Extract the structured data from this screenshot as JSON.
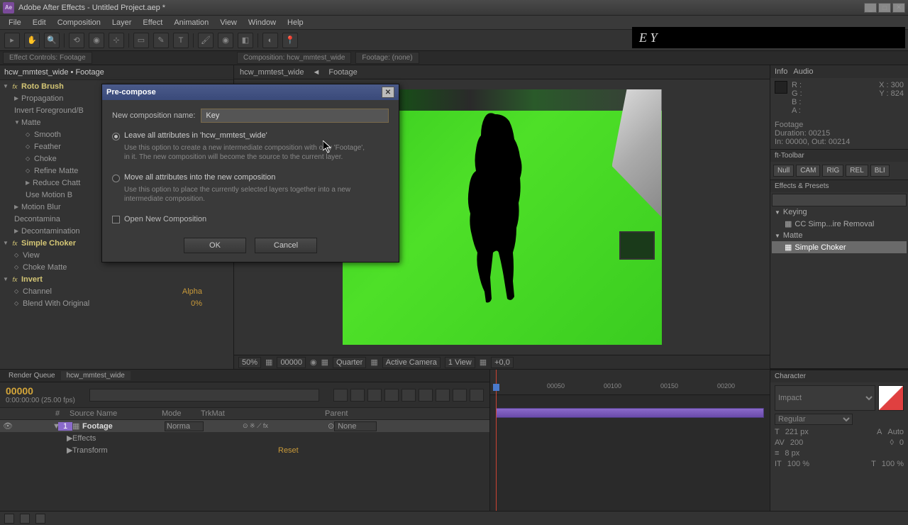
{
  "titlebar": {
    "app": "Ae",
    "title": "Adobe After Effects - Untitled Project.aep *"
  },
  "menu": [
    "File",
    "Edit",
    "Composition",
    "Layer",
    "Effect",
    "Animation",
    "View",
    "Window",
    "Help"
  ],
  "key_overlay": "E Y",
  "panel_tabs": {
    "left": "Effect Controls: Footage",
    "center": "Composition: hcw_mmtest_wide",
    "center2": "Footage: (none)"
  },
  "effect_controls": {
    "header": "hcw_mmtest_wide • Footage",
    "fx1": "Roto Brush",
    "fx1_items": [
      "Propagation",
      "Invert Foreground/B",
      "Matte",
      "Smooth",
      "Feather",
      "Choke",
      "Refine Matte",
      "Reduce Chatt",
      "Use Motion B",
      "Motion Blur",
      "Decontamina",
      "Decontamination"
    ],
    "fx2": "Simple Choker",
    "fx2_items": [
      "View",
      "Choke Matte"
    ],
    "fx3": "Invert",
    "fx3_items": [
      "Channel",
      "Blend With Original"
    ],
    "channel_val": "Alpha",
    "blend_val": "0%"
  },
  "comp_nav": {
    "comp": "hcw_mmtest_wide",
    "layer": "Footage"
  },
  "viewer_controls": {
    "zoom": "50%",
    "time": "00000",
    "res": "Quarter",
    "cam": "Active Camera",
    "view": "1 View",
    "exp": "+0,0"
  },
  "info_panel": {
    "title": "Info",
    "title2": "Audio",
    "r": "R :",
    "g": "G :",
    "b": "B :",
    "a": "A :",
    "x": "X : 300",
    "y": "Y : 824",
    "footage": "Footage",
    "duration": "Duration: 00215",
    "inout": "In: 00000, Out: 00214"
  },
  "toolbar_panel": {
    "title": "ft-Toolbar",
    "btns": [
      "Null",
      "CAM",
      "RIG",
      "REL",
      "BLI"
    ]
  },
  "effects_presets": {
    "title": "Effects & Presets",
    "cat1": "Keying",
    "item1": "CC Simp...ire Removal",
    "cat2": "Matte",
    "item2": "Simple Choker"
  },
  "timeline": {
    "tab1": "Render Queue",
    "tab2": "hcw_mmtest_wide",
    "timecode": "00000",
    "fps": "0:00:00:00 (25.00 fps)",
    "col_num": "#",
    "col_src": "Source Name",
    "col_mode": "Mode",
    "col_trk": "TrkMat",
    "col_parent": "Parent",
    "layer1_num": "1",
    "layer1_name": "Footage",
    "layer1_mode": "Norma",
    "layer1_parent": "None",
    "sub1": "Effects",
    "sub2": "Transform",
    "sub2_val": "Reset",
    "ticks": [
      "00050",
      "00100",
      "00150",
      "00200"
    ]
  },
  "char_panel": {
    "title": "Character",
    "font": "Impact",
    "style": "Regular",
    "size": "221 px",
    "auto": "Auto",
    "track": "200",
    "kern": "0",
    "stroke": "8 px",
    "vscale": "100 %",
    "hscale": "100 %"
  },
  "dialog": {
    "title": "Pre-compose",
    "name_label": "New composition name:",
    "name_value": "Key",
    "opt1_label": "Leave all attributes in 'hcw_mmtest_wide'",
    "opt1_desc": "Use this option to create a new intermediate composition with only 'Footage', in it. The new composition will become the source to the current layer.",
    "opt2_label": "Move all attributes into the new composition",
    "opt2_desc": "Use this option to place the currently selected layers together into a new intermediate composition.",
    "check_label": "Open New Composition",
    "ok": "OK",
    "cancel": "Cancel"
  }
}
